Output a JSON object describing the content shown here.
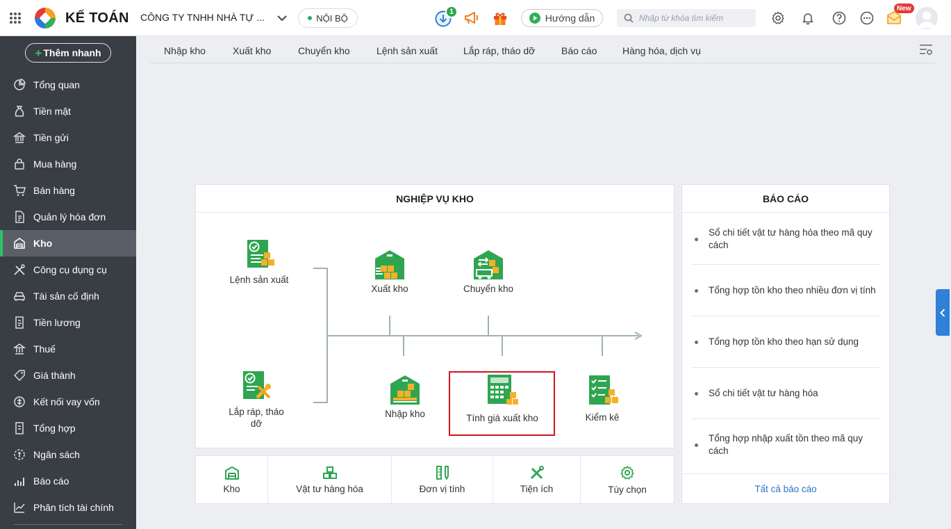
{
  "header": {
    "brand": "KẾ TOÁN",
    "company": "CÔNG TY TNHH NHÀ TỰ ...",
    "scope": "NỘI BỘ",
    "download_badge": "1",
    "guide_label": "Hướng dẫn",
    "search_placeholder": "Nhập từ khóa tìm kiếm",
    "new_badge": "New"
  },
  "sidebar": {
    "quick_add": "Thêm nhanh",
    "items": [
      {
        "label": "Tổng quan",
        "icon": "pie-chart-icon"
      },
      {
        "label": "Tiền mặt",
        "icon": "money-bag-icon"
      },
      {
        "label": "Tiền gửi",
        "icon": "bank-icon"
      },
      {
        "label": "Mua hàng",
        "icon": "shopping-bag-icon"
      },
      {
        "label": "Bán hàng",
        "icon": "cart-icon"
      },
      {
        "label": "Quản lý hóa đơn",
        "icon": "invoice-icon"
      },
      {
        "label": "Kho",
        "icon": "warehouse-icon"
      },
      {
        "label": "Công cụ dụng cụ",
        "icon": "tools-icon"
      },
      {
        "label": "Tài sản cố định",
        "icon": "car-icon"
      },
      {
        "label": "Tiền lương",
        "icon": "payroll-icon"
      },
      {
        "label": "Thuế",
        "icon": "tax-icon"
      },
      {
        "label": "Giá thành",
        "icon": "price-tag-icon"
      },
      {
        "label": "Kết nối vay vốn",
        "icon": "loan-icon"
      },
      {
        "label": "Tổng hợp",
        "icon": "summary-icon"
      },
      {
        "label": "Ngân sách",
        "icon": "budget-icon"
      },
      {
        "label": "Báo cáo",
        "icon": "bar-chart-icon"
      },
      {
        "label": "Phân tích tài chính",
        "icon": "analysis-icon"
      }
    ],
    "active_index": 6
  },
  "tabs": [
    "Nhập kho",
    "Xuất kho",
    "Chuyển kho",
    "Lệnh sản xuất",
    "Lắp ráp, tháo dỡ",
    "Báo cáo",
    "Hàng hóa, dịch vụ"
  ],
  "operations": {
    "title": "NGHIỆP VỤ KHO",
    "production_order": "Lệnh sản xuất",
    "assembly": "Lắp ráp, tháo dỡ",
    "export": "Xuất kho",
    "transfer": "Chuyển kho",
    "import": "Nhập kho",
    "costing": "Tính giá xuất kho",
    "inventory_check": "Kiểm kê"
  },
  "reports": {
    "title": "BÁO CÁO",
    "items": [
      "Sổ chi tiết vật tư hàng hóa theo mã quy cách",
      "Tổng hợp tồn kho theo nhiều đơn vị tính",
      "Tổng hợp tồn kho theo hạn sử dụng",
      "Sổ chi tiết vật tư hàng hóa",
      "Tổng hợp nhập xuất tồn theo mã quy cách"
    ],
    "all_link": "Tất cả báo cáo"
  },
  "shortcuts": [
    "Kho",
    "Vật tư hàng hóa",
    "Đơn vị tính",
    "Tiện ích",
    "Tùy chọn"
  ],
  "colors": {
    "accent_green": "#2fc06b",
    "sidebar_bg": "#393d44",
    "highlight_red": "#d0141b",
    "link_blue": "#2a74c9"
  }
}
